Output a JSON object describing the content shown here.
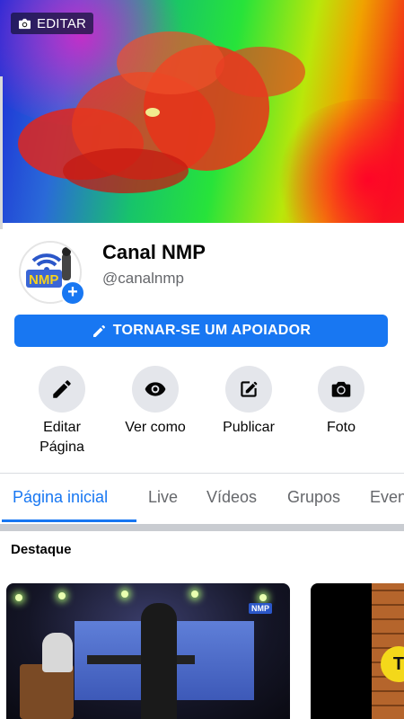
{
  "cover": {
    "edit_label": "EDITAR"
  },
  "profile": {
    "name": "Canal NMP",
    "handle": "@canalnmp",
    "avatar_text": "NMP"
  },
  "support_button": {
    "label": "TORNAR-SE UM APOIADOR"
  },
  "actions": [
    {
      "label": "Editar Página",
      "icon": "pencil-icon"
    },
    {
      "label": "Ver como",
      "icon": "eye-icon"
    },
    {
      "label": "Publicar",
      "icon": "compose-icon"
    },
    {
      "label": "Foto",
      "icon": "camera-icon"
    }
  ],
  "tabs": [
    {
      "label": "Página inicial",
      "active": true
    },
    {
      "label": "Live"
    },
    {
      "label": "Vídeos"
    },
    {
      "label": "Grupos"
    },
    {
      "label": "Eventos"
    }
  ],
  "featured": {
    "title": "Destaque",
    "video1_logo": "NMP"
  },
  "colors": {
    "accent": "#1877f2",
    "icon_circle": "#e4e6eb"
  }
}
